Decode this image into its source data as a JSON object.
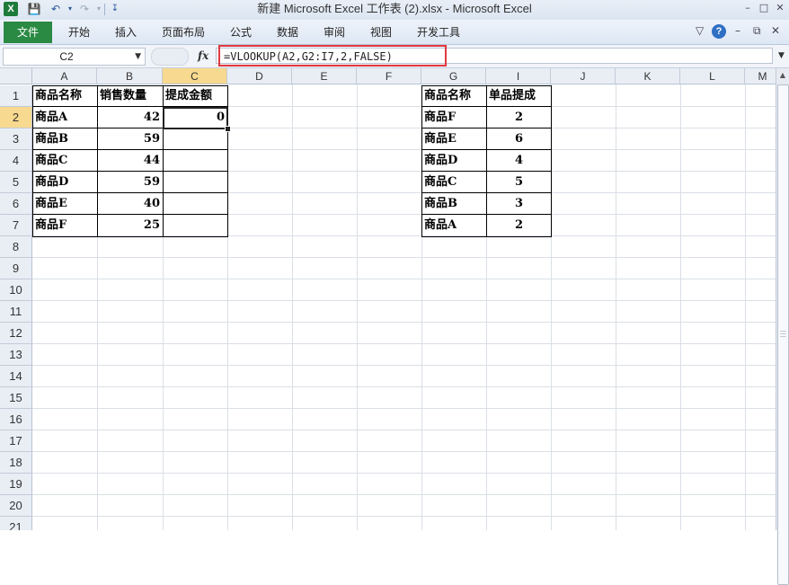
{
  "titlebar": {
    "app_icon": "excel-icon",
    "title": "新建 Microsoft Excel 工作表 (2).xlsx  -  Microsoft Excel",
    "qat": {
      "save": "save-icon",
      "undo": "undo-icon",
      "redo": "redo-icon",
      "customize": "customize-qat-icon"
    },
    "window_buttons": {
      "minimize": "–",
      "maximize": "□",
      "close": "✕"
    }
  },
  "ribbon": {
    "file_tab": "文件",
    "tabs": [
      "开始",
      "插入",
      "页面布局",
      "公式",
      "数据",
      "审阅",
      "视图",
      "开发工具"
    ],
    "right_icons": {
      "collapse": "▽",
      "help": "?"
    }
  },
  "formula_bar": {
    "name_box": "C2",
    "fx_label": "fx",
    "formula": "=VLOOKUP(A2,G2:I7,2,FALSE)"
  },
  "sheet": {
    "columns": [
      "A",
      "B",
      "C",
      "D",
      "E",
      "F",
      "G",
      "I",
      "J",
      "K",
      "L",
      "M"
    ],
    "rows": [
      "1",
      "2",
      "3",
      "4",
      "5",
      "6",
      "7",
      "8",
      "9",
      "10",
      "11",
      "12",
      "13",
      "14",
      "15",
      "16",
      "17",
      "18",
      "19",
      "20",
      "21"
    ],
    "selected_column": "C",
    "selected_row": "2",
    "table_left": {
      "headers": [
        "商品名称",
        "销售数量",
        "提成金额"
      ],
      "rows": [
        [
          "商品A",
          "42",
          "0"
        ],
        [
          "商品B",
          "59",
          ""
        ],
        [
          "商品C",
          "44",
          ""
        ],
        [
          "商品D",
          "59",
          ""
        ],
        [
          "商品E",
          "40",
          ""
        ],
        [
          "商品F",
          "25",
          ""
        ]
      ]
    },
    "table_right": {
      "headers": [
        "商品名称",
        "单品提成"
      ],
      "rows": [
        [
          "商品F",
          "2"
        ],
        [
          "商品E",
          "6"
        ],
        [
          "商品D",
          "4"
        ],
        [
          "商品C",
          "5"
        ],
        [
          "商品B",
          "3"
        ],
        [
          "商品A",
          "2"
        ]
      ]
    }
  }
}
